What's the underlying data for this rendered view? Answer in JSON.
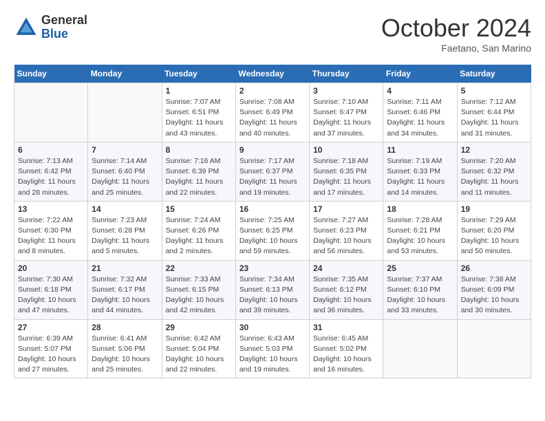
{
  "header": {
    "logo_general": "General",
    "logo_blue": "Blue",
    "month_title": "October 2024",
    "subtitle": "Faetano, San Marino"
  },
  "weekdays": [
    "Sunday",
    "Monday",
    "Tuesday",
    "Wednesday",
    "Thursday",
    "Friday",
    "Saturday"
  ],
  "weeks": [
    [
      {
        "day": "",
        "info": ""
      },
      {
        "day": "",
        "info": ""
      },
      {
        "day": "1",
        "info": "Sunrise: 7:07 AM\nSunset: 6:51 PM\nDaylight: 11 hours\nand 43 minutes."
      },
      {
        "day": "2",
        "info": "Sunrise: 7:08 AM\nSunset: 6:49 PM\nDaylight: 11 hours\nand 40 minutes."
      },
      {
        "day": "3",
        "info": "Sunrise: 7:10 AM\nSunset: 6:47 PM\nDaylight: 11 hours\nand 37 minutes."
      },
      {
        "day": "4",
        "info": "Sunrise: 7:11 AM\nSunset: 6:46 PM\nDaylight: 11 hours\nand 34 minutes."
      },
      {
        "day": "5",
        "info": "Sunrise: 7:12 AM\nSunset: 6:44 PM\nDaylight: 11 hours\nand 31 minutes."
      }
    ],
    [
      {
        "day": "6",
        "info": "Sunrise: 7:13 AM\nSunset: 6:42 PM\nDaylight: 11 hours\nand 28 minutes."
      },
      {
        "day": "7",
        "info": "Sunrise: 7:14 AM\nSunset: 6:40 PM\nDaylight: 11 hours\nand 25 minutes."
      },
      {
        "day": "8",
        "info": "Sunrise: 7:16 AM\nSunset: 6:39 PM\nDaylight: 11 hours\nand 22 minutes."
      },
      {
        "day": "9",
        "info": "Sunrise: 7:17 AM\nSunset: 6:37 PM\nDaylight: 11 hours\nand 19 minutes."
      },
      {
        "day": "10",
        "info": "Sunrise: 7:18 AM\nSunset: 6:35 PM\nDaylight: 11 hours\nand 17 minutes."
      },
      {
        "day": "11",
        "info": "Sunrise: 7:19 AM\nSunset: 6:33 PM\nDaylight: 11 hours\nand 14 minutes."
      },
      {
        "day": "12",
        "info": "Sunrise: 7:20 AM\nSunset: 6:32 PM\nDaylight: 11 hours\nand 11 minutes."
      }
    ],
    [
      {
        "day": "13",
        "info": "Sunrise: 7:22 AM\nSunset: 6:30 PM\nDaylight: 11 hours\nand 8 minutes."
      },
      {
        "day": "14",
        "info": "Sunrise: 7:23 AM\nSunset: 6:28 PM\nDaylight: 11 hours\nand 5 minutes."
      },
      {
        "day": "15",
        "info": "Sunrise: 7:24 AM\nSunset: 6:26 PM\nDaylight: 11 hours\nand 2 minutes."
      },
      {
        "day": "16",
        "info": "Sunrise: 7:25 AM\nSunset: 6:25 PM\nDaylight: 10 hours\nand 59 minutes."
      },
      {
        "day": "17",
        "info": "Sunrise: 7:27 AM\nSunset: 6:23 PM\nDaylight: 10 hours\nand 56 minutes."
      },
      {
        "day": "18",
        "info": "Sunrise: 7:28 AM\nSunset: 6:21 PM\nDaylight: 10 hours\nand 53 minutes."
      },
      {
        "day": "19",
        "info": "Sunrise: 7:29 AM\nSunset: 6:20 PM\nDaylight: 10 hours\nand 50 minutes."
      }
    ],
    [
      {
        "day": "20",
        "info": "Sunrise: 7:30 AM\nSunset: 6:18 PM\nDaylight: 10 hours\nand 47 minutes."
      },
      {
        "day": "21",
        "info": "Sunrise: 7:32 AM\nSunset: 6:17 PM\nDaylight: 10 hours\nand 44 minutes."
      },
      {
        "day": "22",
        "info": "Sunrise: 7:33 AM\nSunset: 6:15 PM\nDaylight: 10 hours\nand 42 minutes."
      },
      {
        "day": "23",
        "info": "Sunrise: 7:34 AM\nSunset: 6:13 PM\nDaylight: 10 hours\nand 39 minutes."
      },
      {
        "day": "24",
        "info": "Sunrise: 7:35 AM\nSunset: 6:12 PM\nDaylight: 10 hours\nand 36 minutes."
      },
      {
        "day": "25",
        "info": "Sunrise: 7:37 AM\nSunset: 6:10 PM\nDaylight: 10 hours\nand 33 minutes."
      },
      {
        "day": "26",
        "info": "Sunrise: 7:38 AM\nSunset: 6:09 PM\nDaylight: 10 hours\nand 30 minutes."
      }
    ],
    [
      {
        "day": "27",
        "info": "Sunrise: 6:39 AM\nSunset: 5:07 PM\nDaylight: 10 hours\nand 27 minutes."
      },
      {
        "day": "28",
        "info": "Sunrise: 6:41 AM\nSunset: 5:06 PM\nDaylight: 10 hours\nand 25 minutes."
      },
      {
        "day": "29",
        "info": "Sunrise: 6:42 AM\nSunset: 5:04 PM\nDaylight: 10 hours\nand 22 minutes."
      },
      {
        "day": "30",
        "info": "Sunrise: 6:43 AM\nSunset: 5:03 PM\nDaylight: 10 hours\nand 19 minutes."
      },
      {
        "day": "31",
        "info": "Sunrise: 6:45 AM\nSunset: 5:02 PM\nDaylight: 10 hours\nand 16 minutes."
      },
      {
        "day": "",
        "info": ""
      },
      {
        "day": "",
        "info": ""
      }
    ]
  ]
}
